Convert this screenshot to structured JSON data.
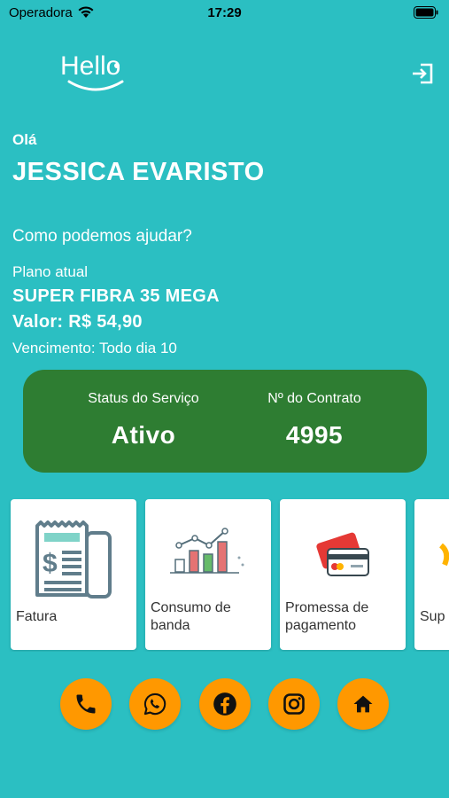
{
  "status_bar": {
    "carrier": "Operadora",
    "time": "17:29"
  },
  "header": {
    "logo_text": "Hello"
  },
  "user": {
    "greeting": "Olá",
    "name": "JESSICA EVARISTO",
    "help_text": "Como podemos ajudar?"
  },
  "plan": {
    "label": "Plano atual",
    "name": "SUPER FIBRA 35 MEGA",
    "price": "Valor: R$ 54,90",
    "due": "Vencimento: Todo dia 10"
  },
  "service": {
    "status_label": "Status do Serviço",
    "status_value": "Ativo",
    "contract_label": "Nº do Contrato",
    "contract_value": "4995"
  },
  "menu": [
    {
      "label": "Fatura",
      "icon": "invoice-icon"
    },
    {
      "label": "Consumo de banda",
      "icon": "bandwidth-chart-icon"
    },
    {
      "label": "Promessa de pagamento",
      "icon": "credit-card-icon"
    },
    {
      "label": "Sup",
      "icon": "support-icon"
    }
  ],
  "socials": [
    {
      "icon": "phone-icon"
    },
    {
      "icon": "whatsapp-icon"
    },
    {
      "icon": "facebook-icon"
    },
    {
      "icon": "instagram-icon"
    },
    {
      "icon": "home-icon"
    }
  ],
  "colors": {
    "background": "#2bbfc2",
    "status_card": "#2e7d32",
    "social_button": "#ff9800"
  }
}
